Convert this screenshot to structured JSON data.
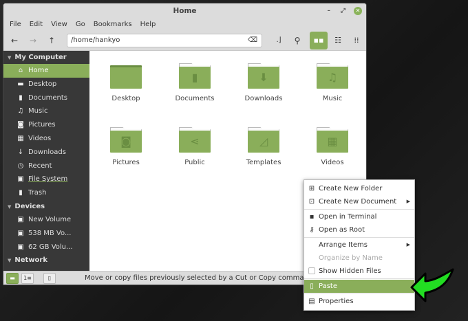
{
  "window": {
    "title": "Home",
    "minimize": "–",
    "maximize": "⤢",
    "close": "✕"
  },
  "menubar": [
    "File",
    "Edit",
    "View",
    "Go",
    "Bookmarks",
    "Help"
  ],
  "toolbar": {
    "path": "/home/hankyo"
  },
  "sidebar": {
    "sections": [
      {
        "title": "My Computer",
        "items": [
          {
            "label": "Home",
            "icon": "⌂",
            "active": true
          },
          {
            "label": "Desktop",
            "icon": "▬"
          },
          {
            "label": "Documents",
            "icon": "▮"
          },
          {
            "label": "Music",
            "icon": "♫"
          },
          {
            "label": "Pictures",
            "icon": "◙"
          },
          {
            "label": "Videos",
            "icon": "▦"
          },
          {
            "label": "Downloads",
            "icon": "↓"
          },
          {
            "label": "Recent",
            "icon": "◷"
          },
          {
            "label": "File System",
            "icon": "▣"
          },
          {
            "label": "Trash",
            "icon": "▮"
          }
        ]
      },
      {
        "title": "Devices",
        "items": [
          {
            "label": "New Volume",
            "icon": "▣"
          },
          {
            "label": "538 MB Vo...",
            "icon": "▣"
          },
          {
            "label": "62 GB Volu...",
            "icon": "▣"
          }
        ]
      },
      {
        "title": "Network",
        "items": []
      }
    ]
  },
  "files": [
    {
      "name": "Desktop",
      "glyph": ""
    },
    {
      "name": "Documents",
      "glyph": "▮"
    },
    {
      "name": "Downloads",
      "glyph": "⬇"
    },
    {
      "name": "Music",
      "glyph": "♫"
    },
    {
      "name": "Pictures",
      "glyph": "◙"
    },
    {
      "name": "Public",
      "glyph": "⋖"
    },
    {
      "name": "Templates",
      "glyph": "◿"
    },
    {
      "name": "Videos",
      "glyph": "▦"
    }
  ],
  "status": {
    "text": "Move or copy files previously selected by a Cut or Copy command"
  },
  "context_menu": [
    {
      "label": "Create New Folder",
      "icon": "⊞"
    },
    {
      "label": "Create New Document",
      "icon": "⊡",
      "sub": true
    },
    {
      "sep": true
    },
    {
      "label": "Open in Terminal",
      "icon": "▪"
    },
    {
      "label": "Open as Root",
      "icon": "⚷"
    },
    {
      "sep": true
    },
    {
      "label": "Arrange Items",
      "sub": true
    },
    {
      "label": "Organize by Name",
      "disabled": true
    },
    {
      "label": "Show Hidden Files",
      "check": true
    },
    {
      "sep": true
    },
    {
      "label": "Paste",
      "icon": "▯",
      "highlight": true
    },
    {
      "sep": true
    },
    {
      "label": "Properties",
      "icon": "▤"
    }
  ],
  "colors": {
    "accent": "#8aae5a",
    "pointer_arrow": "#22dd22"
  }
}
